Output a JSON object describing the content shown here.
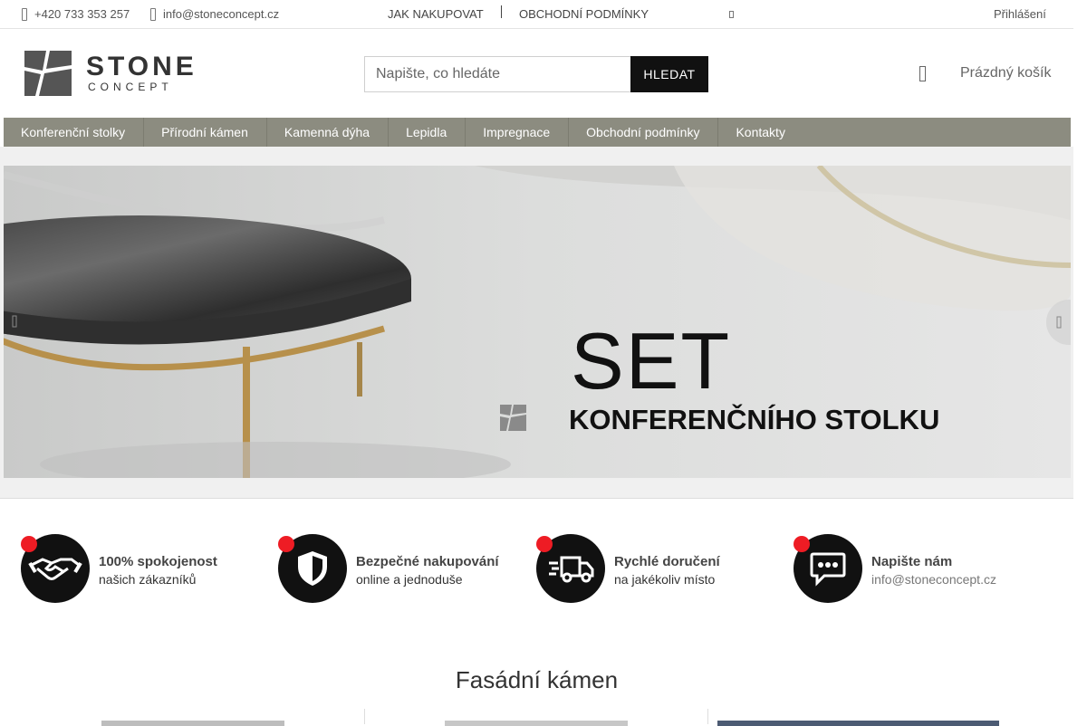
{
  "topbar": {
    "phone": "+420 733 353 257",
    "email": "info@stoneconcept.cz",
    "links": [
      "JAK NAKUPOVAT",
      "OBCHODNÍ PODMÍNKY"
    ],
    "login": "Přihlášení"
  },
  "header": {
    "logo_big": "STONE",
    "logo_small": "CONCEPT",
    "search_placeholder": "Napište, co hledáte",
    "search_button": "HLEDAT",
    "cart_label": "Prázdný košík"
  },
  "nav": {
    "items": [
      "Konferenční stolky",
      "Přírodní kámen",
      "Kamenná dýha",
      "Lepidla",
      "Impregnace",
      "Obchodní podmínky",
      "Kontakty"
    ]
  },
  "banner": {
    "line1": "SET",
    "line2": "KONFERENČNÍHO STOLKU"
  },
  "features": [
    {
      "title": "100% spokojenost",
      "subtitle": "našich zákazníků",
      "icon": "handshake-icon"
    },
    {
      "title": "Bezpečné nakupování",
      "subtitle": "online a jednoduše",
      "icon": "shield-icon"
    },
    {
      "title": "Rychlé doručení",
      "subtitle": "na jakékoliv místo",
      "icon": "truck-icon"
    },
    {
      "title": "Napište nám",
      "subtitle": "info@stoneconcept.cz",
      "icon": "chat-icon"
    }
  ],
  "section": {
    "title": "Fasádní kámen"
  },
  "colors": {
    "nav_bg": "#8c8c80",
    "badge": "#ee1c24",
    "button_bg": "#111111"
  }
}
